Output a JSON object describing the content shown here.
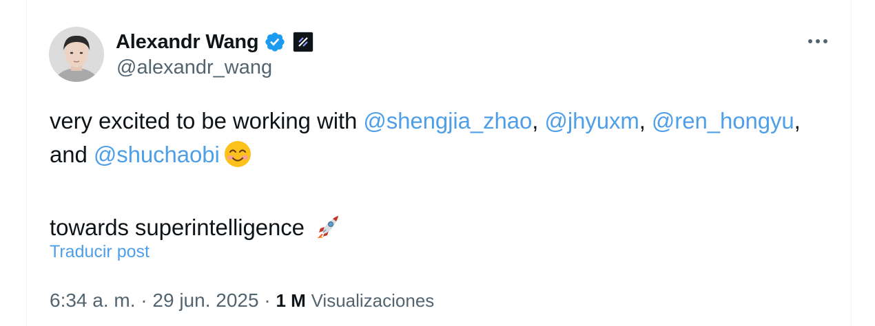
{
  "author": {
    "display_name": "Alexandr Wang",
    "handle": "@alexandr_wang",
    "verified": true,
    "verified_color": "#1d9bf0"
  },
  "tweet": {
    "line1_text": "very excited to be working with ",
    "mention_1": "@shengjia_zhao",
    "sep_1": ", ",
    "mention_2": "@jhyuxm",
    "sep_2": ", ",
    "mention_3": "@ren_hongyu",
    "sep_3": ",",
    "line2_text": "and ",
    "mention_4": "@shuchaobi",
    "emoji_1": "smiling-face-with-smiling-eyes",
    "line3_text": "towards superintelligence ",
    "emoji_2": "rocket"
  },
  "translate_label": "Traducir post",
  "meta": {
    "time": "6:34 a. m.",
    "dot_1": " · ",
    "date": "29 jun. 2025",
    "dot_2": " · ",
    "views_count": "1 M",
    "views_label": "Visualizaciones"
  },
  "icons": {
    "more": "more-horizontal-icon",
    "verified": "verified-badge-icon",
    "affiliate": "affiliate-logo-icon"
  },
  "colors": {
    "link": "#4f9ee8",
    "text": "#0f1419",
    "secondary": "#536471"
  }
}
